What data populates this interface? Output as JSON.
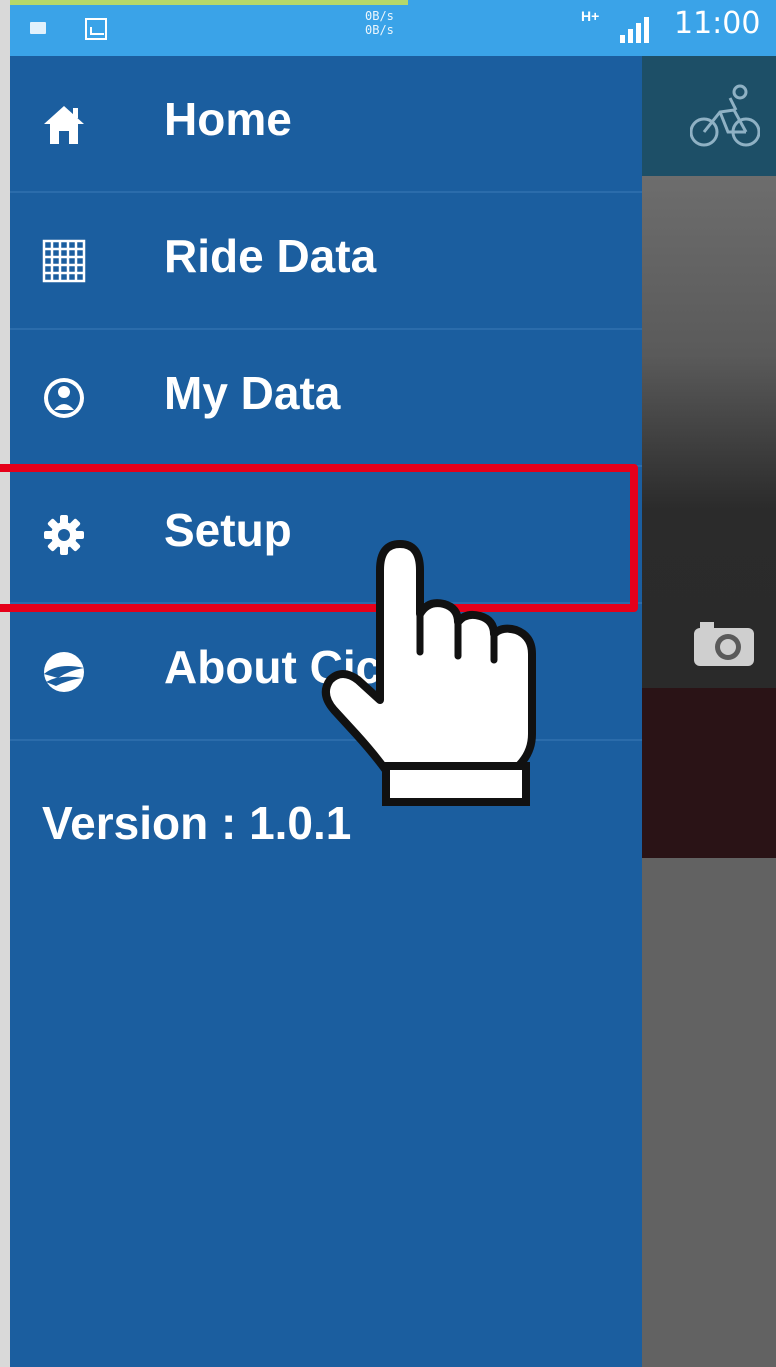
{
  "status_bar": {
    "speed_up": "0B/s",
    "speed_down": "0B/s",
    "network": "H+",
    "time": "11:00"
  },
  "drawer": {
    "items": [
      {
        "label": "Home",
        "icon": "home-icon"
      },
      {
        "label": "Ride Data",
        "icon": "grid-icon"
      },
      {
        "label": "My Data",
        "icon": "user-icon"
      },
      {
        "label": "Setup",
        "icon": "gear-icon"
      },
      {
        "label": "About Cic",
        "icon": "logo-icon"
      }
    ],
    "version": "Version : 1.0.1"
  },
  "background_app": {
    "icons": [
      "cyclist-icon",
      "camera-icon"
    ]
  },
  "annotation": {
    "highlighted_item": "Setup",
    "highlight_color": "#e5001a",
    "pointer": "hand-pointer-icon"
  },
  "colors": {
    "drawer": "#1b5e9f",
    "status_bar": "#3aa3e8",
    "app_header": "#1d4f67"
  }
}
